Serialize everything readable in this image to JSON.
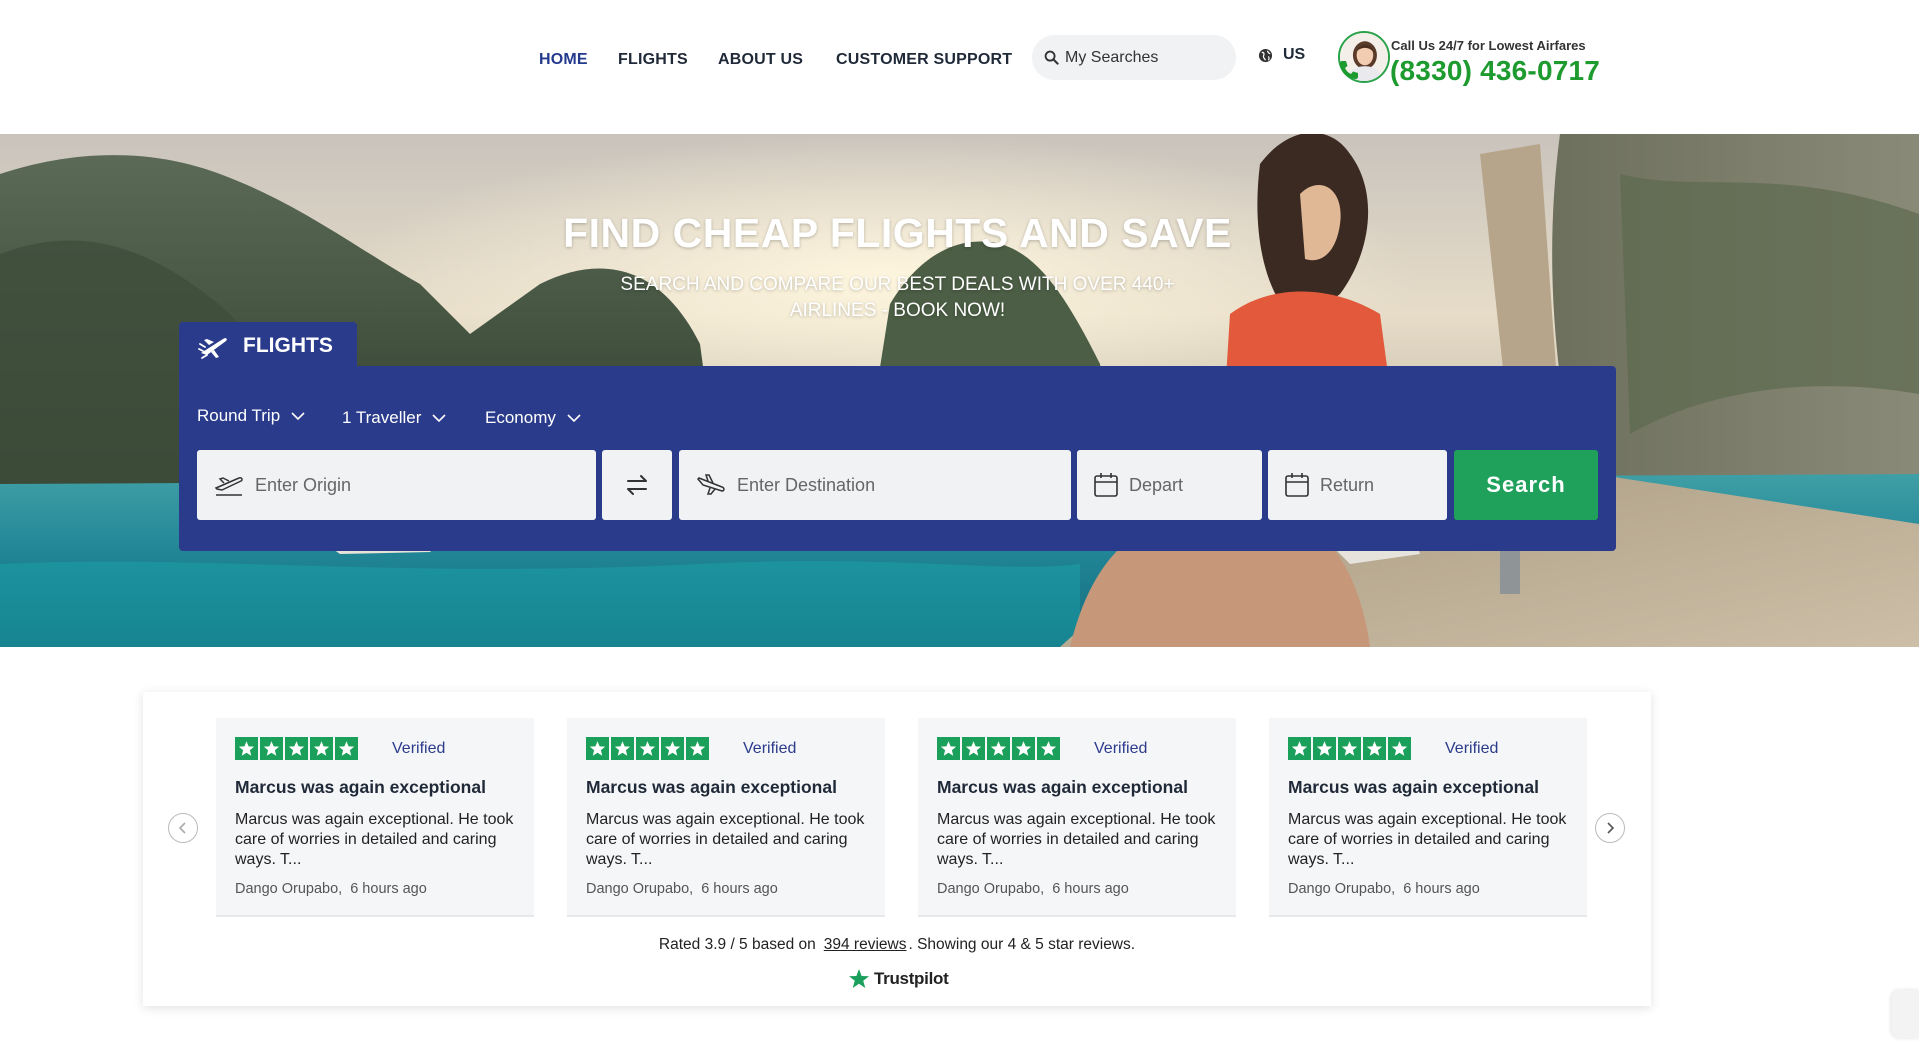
{
  "nav": {
    "items": [
      {
        "label": "HOME",
        "active": true
      },
      {
        "label": "FLIGHTS",
        "active": false
      },
      {
        "label": "ABOUT US",
        "active": false
      },
      {
        "label": "CUSTOMER SUPPORT",
        "active": false
      }
    ],
    "my_searches": "My Searches",
    "locale": "US",
    "call_label": "Call Us 24/7 for Lowest Airfares",
    "phone": "(8330) 436-0717"
  },
  "hero": {
    "title": "FIND CHEAP FLIGHTS AND SAVE",
    "subtitle": "SEARCH AND COMPARE OUR BEST DEALS WITH OVER 440+ AIRLINES - BOOK NOW!"
  },
  "search": {
    "tab_label": "FLIGHTS",
    "trip_type": "Round Trip",
    "travellers": "1 Traveller",
    "cabin": "Economy",
    "origin_placeholder": "Enter Origin",
    "destination_placeholder": "Enter Destination",
    "depart_placeholder": "Depart",
    "return_placeholder": "Return",
    "button": "Search"
  },
  "reviews": {
    "cards": [
      {
        "rating": 5,
        "verified": "Verified",
        "title": "Marcus was again exceptional",
        "body": "Marcus was again exceptional. He took care of worries in detailed and caring ways. T...",
        "author": "Dango Orupabo,",
        "time": "6 hours ago"
      },
      {
        "rating": 5,
        "verified": "Verified",
        "title": "Marcus was again exceptional",
        "body": "Marcus was again exceptional. He took care of worries in detailed and caring ways. T...",
        "author": "Dango Orupabo,",
        "time": "6 hours ago"
      },
      {
        "rating": 5,
        "verified": "Verified",
        "title": "Marcus was again exceptional",
        "body": "Marcus was again exceptional. He took care of worries in detailed and caring ways. T...",
        "author": "Dango Orupabo,",
        "time": "6 hours ago"
      },
      {
        "rating": 5,
        "verified": "Verified",
        "title": "Marcus was again exceptional",
        "body": "Marcus was again exceptional. He took care of worries in detailed and caring ways. T...",
        "author": "Dango Orupabo,",
        "time": "6 hours ago"
      }
    ],
    "rated_prefix": "Rated 3.9 / 5 based on",
    "reviews_link": "394 reviews",
    "rated_suffix": ". Showing our 4 & 5 star reviews.",
    "trustpilot": "Trustpilot"
  },
  "colors": {
    "brand_navy": "#2b3b8c",
    "search_green": "#1fa05b",
    "phone_green": "#1e9b2f",
    "star_green": "#1aa05a"
  },
  "icons": {
    "search": "magnifier-icon",
    "locale": "globe-icon",
    "tab": "airplane-icon",
    "origin": "plane-takeoff-icon",
    "destination": "plane-landing-icon",
    "swap": "swap-arrows-icon",
    "date": "calendar-icon",
    "prev": "chevron-left-icon",
    "next": "chevron-right-icon"
  }
}
